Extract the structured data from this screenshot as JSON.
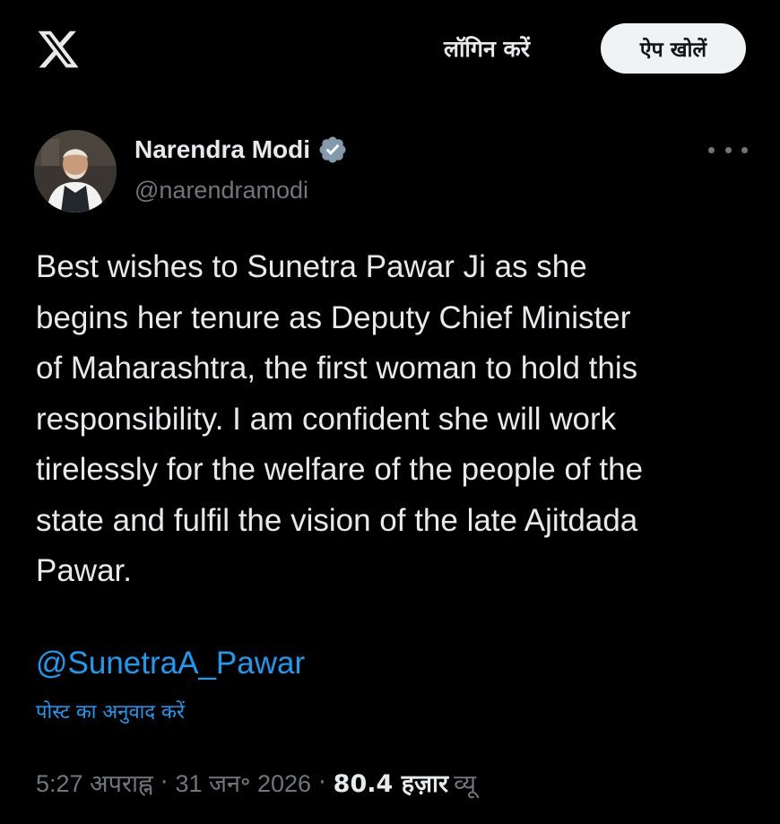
{
  "header": {
    "logo_icon": "x-logo-icon",
    "login_label": "लॉगिन करें",
    "open_app_label": "ऐप खोलें"
  },
  "tweet": {
    "author_name": "Narendra Modi",
    "verified_icon": "verified-badge-icon",
    "handle": "@narendramodi",
    "more_icon": "more-options-icon",
    "text_lines": [
      "Best wishes to Sunetra Pawar Ji as she",
      "begins her tenure as Deputy Chief Minister",
      "of Maharashtra, the first woman to hold this",
      "responsibility. I am confident she will work",
      "tirelessly for the welfare of the people of the",
      "state and fulfil the vision of the late Ajitdada",
      "Pawar."
    ],
    "mention": "@SunetraA_Pawar",
    "translate_label": "पोस्ट का अनुवाद करें",
    "time": "5:27 अपराह्न",
    "date": "31 जन॰ 2026",
    "views_count": "80.4 हज़ार",
    "views_label": "व्यू"
  },
  "colors": {
    "background": "#000000",
    "primary_text": "#e7e9ea",
    "secondary_text": "#71767b",
    "link": "#1d9bf0",
    "verified": "#829aab",
    "button_bg": "#eff3f4"
  }
}
